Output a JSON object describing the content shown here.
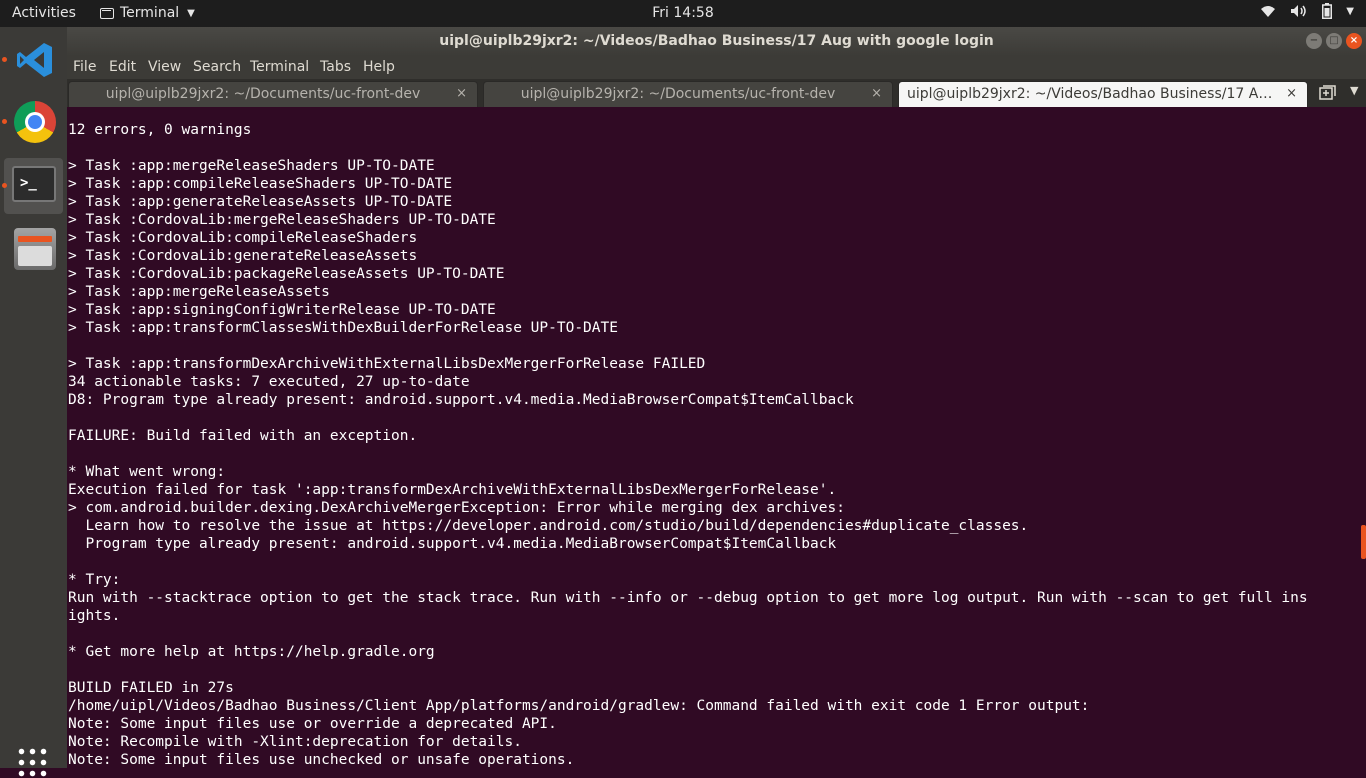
{
  "topbar": {
    "activities": "Activities",
    "app_menu": "Terminal",
    "clock": "Fri 14:58"
  },
  "icons": {
    "wifi": "wifi-icon",
    "volume": "volume-icon",
    "battery": "battery-icon",
    "system_menu": "chevron-down-icon"
  },
  "window": {
    "title": "uipl@uiplb29jxr2: ~/Videos/Badhao Business/17 Aug with google login"
  },
  "menu": [
    "File",
    "Edit",
    "View",
    "Search",
    "Terminal",
    "Tabs",
    "Help"
  ],
  "tabs": [
    {
      "label": "uipl@uiplb29jxr2: ~/Documents/uc-front-dev",
      "active": false
    },
    {
      "label": "uipl@uiplb29jxr2: ~/Documents/uc-front-dev",
      "active": false
    },
    {
      "label": "uipl@uiplb29jxr2: ~/Videos/Badhao Business/17 Aug ...",
      "active": true
    }
  ],
  "terminal": {
    "lines": [
      "12 errors, 0 warnings",
      "",
      "> Task :app:mergeReleaseShaders UP-TO-DATE",
      "> Task :app:compileReleaseShaders UP-TO-DATE",
      "> Task :app:generateReleaseAssets UP-TO-DATE",
      "> Task :CordovaLib:mergeReleaseShaders UP-TO-DATE",
      "> Task :CordovaLib:compileReleaseShaders",
      "> Task :CordovaLib:generateReleaseAssets",
      "> Task :CordovaLib:packageReleaseAssets UP-TO-DATE",
      "> Task :app:mergeReleaseAssets",
      "> Task :app:signingConfigWriterRelease UP-TO-DATE",
      "> Task :app:transformClassesWithDexBuilderForRelease UP-TO-DATE",
      "",
      "> Task :app:transformDexArchiveWithExternalLibsDexMergerForRelease FAILED",
      "34 actionable tasks: 7 executed, 27 up-to-date",
      "D8: Program type already present: android.support.v4.media.MediaBrowserCompat$ItemCallback",
      "",
      "FAILURE: Build failed with an exception.",
      "",
      "* What went wrong:",
      "Execution failed for task ':app:transformDexArchiveWithExternalLibsDexMergerForRelease'.",
      "> com.android.builder.dexing.DexArchiveMergerException: Error while merging dex archives:",
      "  Learn how to resolve the issue at https://developer.android.com/studio/build/dependencies#duplicate_classes.",
      "  Program type already present: android.support.v4.media.MediaBrowserCompat$ItemCallback",
      "",
      "* Try:",
      "Run with --stacktrace option to get the stack trace. Run with --info or --debug option to get more log output. Run with --scan to get full ins",
      "ights.",
      "",
      "* Get more help at https://help.gradle.org",
      "",
      "BUILD FAILED in 27s",
      "/home/uipl/Videos/Badhao Business/Client App/platforms/android/gradlew: Command failed with exit code 1 Error output:",
      "Note: Some input files use or override a deprecated API.",
      "Note: Recompile with -Xlint:deprecation for details.",
      "Note: Some input files use unchecked or unsafe operations."
    ]
  },
  "colors": {
    "terminal_bg": "#300a24",
    "accent": "#e95420",
    "topbar_bg": "#1d1d1d",
    "dock_bg": "#3b3a37"
  }
}
